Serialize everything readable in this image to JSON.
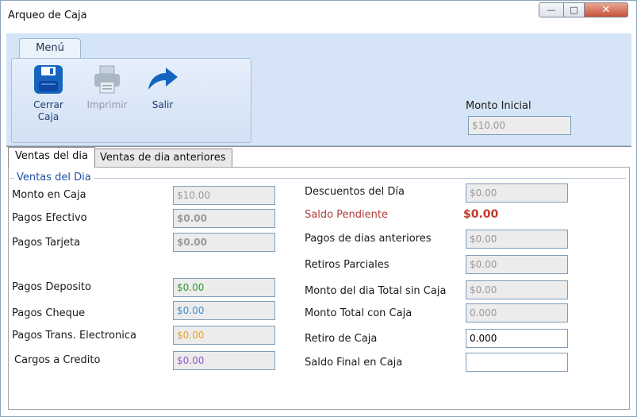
{
  "window": {
    "title": "Arqueo de Caja",
    "controls": {
      "minimize": "—",
      "maximize": "□",
      "close": "✕"
    }
  },
  "ribbon": {
    "tab": "Menú",
    "buttons": [
      {
        "label_line1": "Cerrar",
        "label_line2": "Caja",
        "icon": "save-icon",
        "enabled": true
      },
      {
        "label_line1": "Imprimir",
        "icon": "printer-icon",
        "enabled": false
      },
      {
        "label_line1": "Salir",
        "icon": "exit-arrow-icon",
        "enabled": true
      }
    ],
    "monto_inicial": {
      "label": "Monto Inicial",
      "value": "$10.00"
    }
  },
  "tabs": [
    {
      "label": "Ventas del dia",
      "active": true
    },
    {
      "label": "Ventas de dia anteriores",
      "active": false
    }
  ],
  "group": {
    "title": "Ventas del Dia"
  },
  "left_fields": [
    {
      "label": "Monto en Caja",
      "value": "$10.00",
      "color": "#9a9a9a",
      "bold": false
    },
    {
      "label": "Pagos Efectivo",
      "value": "$0.00",
      "color": "#9a9a9a",
      "bold": true
    },
    {
      "label": "Pagos Tarjeta",
      "value": "$0.00",
      "color": "#9a9a9a",
      "bold": true
    },
    {
      "label": "Pagos Deposito",
      "value": "$0.00",
      "color": "#2e9a2e",
      "bold": false
    },
    {
      "label": "Pagos Cheque",
      "value": "$0.00",
      "color": "#3a8fd6",
      "bold": false
    },
    {
      "label": "Pagos Trans. Electronica",
      "value": "$0.00",
      "color": "#f0a020",
      "bold": false
    },
    {
      "label": "Cargos a Credito",
      "value": "$0.00",
      "color": "#9b4fd0",
      "bold": false
    }
  ],
  "right_fields": [
    {
      "label": "Descuentos del Día",
      "value": "$0.00"
    },
    {
      "label": "Saldo Pendiente",
      "value": "$0.00"
    },
    {
      "label": "Pagos de dias anteriores",
      "value": "$0.00"
    },
    {
      "label": "Retiros Parciales",
      "value": "$0.00"
    },
    {
      "label": "Monto del dia Total sin Caja",
      "value": "$0.00"
    },
    {
      "label": "Monto Total con Caja",
      "value": "0.000"
    },
    {
      "label": "Retiro de Caja",
      "value": "0.000"
    },
    {
      "label": "Saldo Final en Caja",
      "value": ""
    }
  ],
  "colors": {
    "ribbon_bg": "#d5e4f6",
    "accent_blue": "#1565c0",
    "saldo_red": "#c0392b"
  }
}
